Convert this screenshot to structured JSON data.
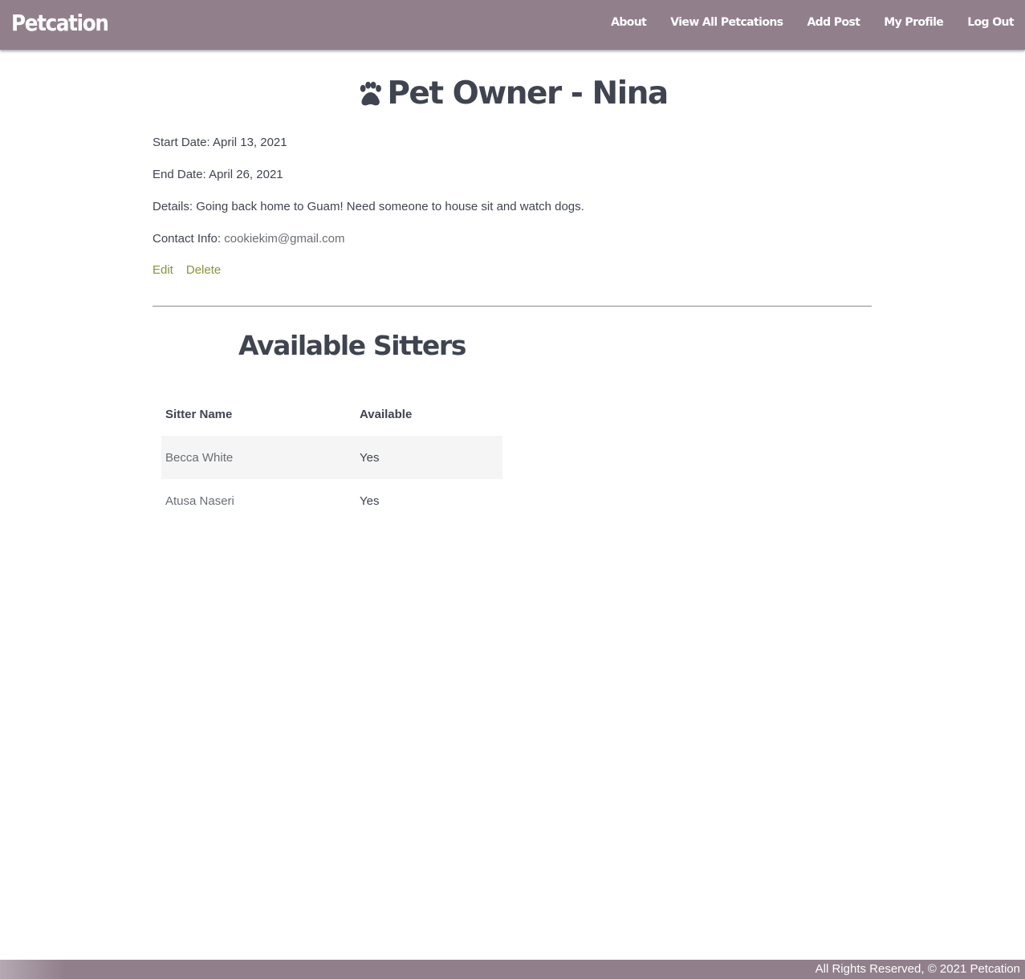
{
  "navbar": {
    "brand": "Petcation",
    "links": [
      "About",
      "View All Petcations",
      "Add Post",
      "My Profile",
      "Log Out"
    ],
    "background_color": "#917f8c"
  },
  "post": {
    "title": "Pet Owner - Nina",
    "title_icon": "paw-icon",
    "start_label": "Start Date:",
    "start_value": "April 13, 2021",
    "end_label": "End Date:",
    "end_value": "April 26, 2021",
    "details_label": "Details:",
    "details_value": "Going back home to Guam! Need someone to house sit and watch dogs.",
    "contact_label": "Contact Info:",
    "contact_value": "cookiekim@gmail.com",
    "edit_label": "Edit",
    "delete_label": "Delete",
    "action_color": "#8a913c"
  },
  "sitters": {
    "title": "Available Sitters",
    "headers": [
      "Sitter Name",
      "Available"
    ],
    "rows": [
      {
        "name": "Becca White",
        "available": "Yes"
      },
      {
        "name": "Atusa Naseri",
        "available": "Yes"
      }
    ]
  },
  "footer": {
    "text": "All Rights Reserved, © 2021 Petcation"
  }
}
